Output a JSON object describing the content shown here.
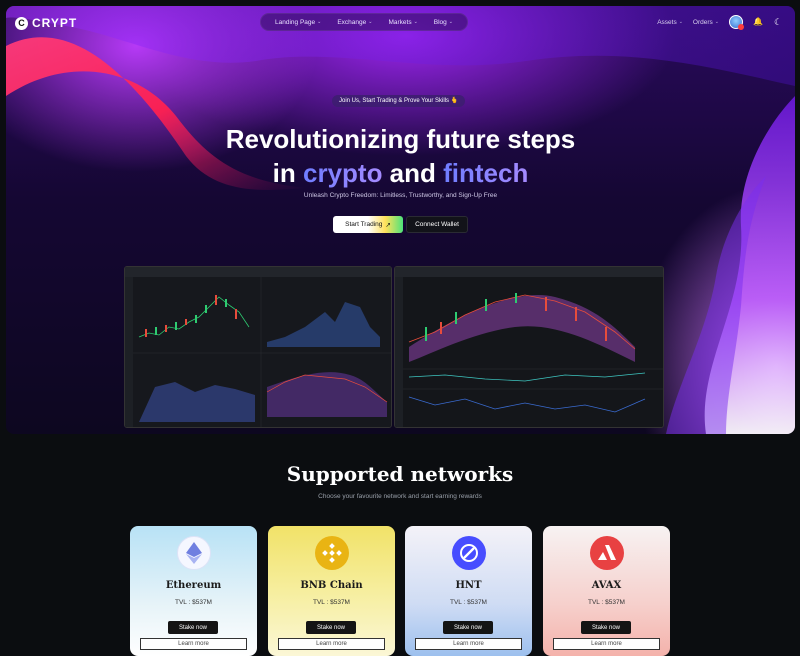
{
  "brand": {
    "logo_letter": "C",
    "name": "CRYPT"
  },
  "nav": {
    "menu": [
      {
        "label": "Landing Page"
      },
      {
        "label": "Exchange"
      },
      {
        "label": "Markets"
      },
      {
        "label": "Blog"
      }
    ],
    "right": [
      {
        "label": "Assets"
      },
      {
        "label": "Orders"
      }
    ],
    "icons": [
      "avatar",
      "bell-icon",
      "moon-icon"
    ]
  },
  "hero": {
    "pill": "Join Us, Start Trading & Prove Your Skills 🫰",
    "title_line1": "Revolutionizing future steps",
    "title_line2_pre": "in ",
    "title_line2_grad": "crypto",
    "title_line2_mid": " and ",
    "title_line2_grad2": "fintech",
    "subtitle": "Unleash Crypto Freedom: Limitless, Trustworthy, and Sign-Up Free",
    "cta_primary": "Start Trading",
    "cta_secondary": "Connect Wallet"
  },
  "networks": {
    "title": "Supported networks",
    "subtitle": "Choose your favourite network and start earning rewards",
    "stake_label": "Stake now",
    "learn_label": "Learn more",
    "cards": [
      {
        "name": "Ethereum",
        "tvl": "TVL : $537M",
        "icon": "ethereum-icon",
        "icon_color": "#6f7fe0"
      },
      {
        "name": "BNB Chain",
        "tvl": "TVL : $537M",
        "icon": "bnb-icon",
        "icon_color": "#e9b413"
      },
      {
        "name": "HNT",
        "tvl": "TVL : $537M",
        "icon": "helium-icon",
        "icon_color": "#474dff"
      },
      {
        "name": "AVAX",
        "tvl": "TVL : $537M",
        "icon": "avalanche-icon",
        "icon_color": "#e84142"
      }
    ]
  }
}
